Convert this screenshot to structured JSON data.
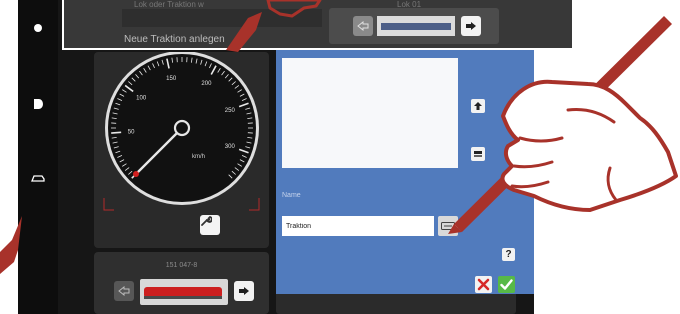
{
  "top_dialog": {
    "topleft_text": "Lok oder Traktion w",
    "topright_text": "Lok 01",
    "new_traction_label": "Neue Traktion anlegen"
  },
  "speedometer": {
    "unit": "km/h",
    "tick_labels": [
      "50",
      "100",
      "150",
      "200",
      "250",
      "300"
    ],
    "speed_value": 0
  },
  "loco": {
    "id": "151 047-8"
  },
  "traction_editor": {
    "name_label": "Name",
    "name_value": "Traktion",
    "help_label": "?"
  },
  "colors": {
    "panel_blue": "#517bbd",
    "pen_red": "#a8322a",
    "loco_red": "#cc1f1f",
    "cancel_red": "#d62828",
    "confirm_green": "#57b947"
  },
  "icons": [
    "rail-dot-icon",
    "rail-half-icon",
    "rail-loco-icon",
    "wrench-icon",
    "arrow-left-icon",
    "arrow-right-icon",
    "upload-icon",
    "download-icon",
    "keyboard-icon",
    "speaker-icon"
  ]
}
